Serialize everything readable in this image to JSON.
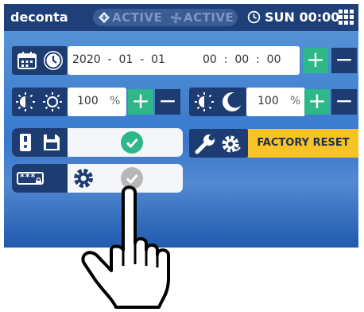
{
  "header": {
    "brand": "deconta",
    "mode1": "ACTIVE",
    "mode2": "ACTIVE",
    "day_time": "SUN 00:00"
  },
  "datetime": {
    "date": "2020  -  01  -  01",
    "time": "00  :  00  :  00",
    "plus": "+",
    "minus": "−"
  },
  "brightness_day": {
    "value": "100",
    "unit": "%",
    "plus": "+",
    "minus": "−"
  },
  "brightness_night": {
    "value": "100",
    "unit": "%",
    "plus": "+",
    "minus": "−"
  },
  "factory_reset": {
    "label": "FACTORY RESET"
  },
  "password": {
    "mask": "***"
  },
  "colors": {
    "topbar": "#1f3f78",
    "accent_green": "#2eb88a",
    "factory_yellow": "#f7c325"
  },
  "icons": [
    "diamond-mode-icon",
    "fan-icon",
    "clock-icon",
    "grid-menu-icon",
    "calendar-icon",
    "clock-icon",
    "brightness-day-icon",
    "sun-icon",
    "brightness-night-icon",
    "moon-icon",
    "sd-card-icon",
    "save-icon",
    "check-icon",
    "wrench-icon",
    "gear-reset-icon",
    "password-lock-icon",
    "gear-icon",
    "check-icon",
    "hand-pointer-icon"
  ]
}
